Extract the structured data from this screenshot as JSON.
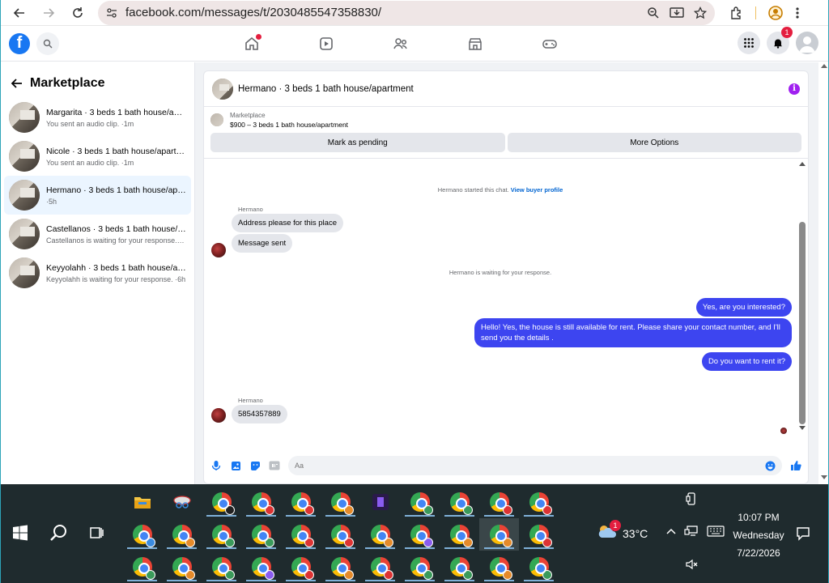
{
  "browser": {
    "url": "facebook.com/messages/t/2030485547358830/"
  },
  "fb": {
    "notif_count": "1"
  },
  "sidebar": {
    "title": "Marketplace",
    "threads": [
      {
        "title": "Margarita · 3 beds 1 bath house/apartment",
        "sub": "You sent an audio clip. ·1m",
        "active": false
      },
      {
        "title": "Nicole · 3 beds 1 bath house/apartment",
        "sub": "You sent an audio clip. ·1m",
        "active": false
      },
      {
        "title": "Hermano · 3 beds 1 bath house/apartment",
        "sub": "·5h",
        "active": true
      },
      {
        "title": "Castellanos · 3 beds 1 bath house/apartment",
        "sub": "Castellanos is waiting for your response. · 6h",
        "active": false
      },
      {
        "title": "Keyyolahh · 3 beds 1 bath house/apartment",
        "sub": "Keyyolahh is waiting for your response. ·6h",
        "active": false
      }
    ]
  },
  "chat": {
    "header_name": "Hermano · 3 beds 1 bath house/apartment",
    "mp_label": "Marketplace",
    "mp_listing": "$900 – 3 beds 1 bath house/apartment",
    "btn_pending": "Mark as pending",
    "btn_more": "More Options",
    "started": "Hermano started this chat.",
    "view_profile": "View buyer profile",
    "sender1": "Hermano",
    "msg_in_1": "Address please for this place",
    "msg_in_2": "Message sent",
    "waiting": "Hermano is waiting for your response.",
    "msg_out_1": "Yes, are you interested?",
    "msg_out_2": "Hello! Yes, the house is still available for rent. Please share your contact number, and I'll send you the details .",
    "msg_out_3": "Do you want to rent it?",
    "sender2": "Hermano",
    "msg_in_3": "5854357889",
    "input_placeholder": "Aa"
  },
  "taskbar": {
    "temp": "33°C",
    "weather_badge": "1",
    "time": "10:07 PM",
    "day": "Wednesday",
    "date": "7/22/2026"
  },
  "colors": {
    "fb_blue": "#1877f2",
    "out_bubble": "#3d45f0",
    "in_bubble": "#e4e6eb",
    "taskbar": "#1f2b2e"
  }
}
